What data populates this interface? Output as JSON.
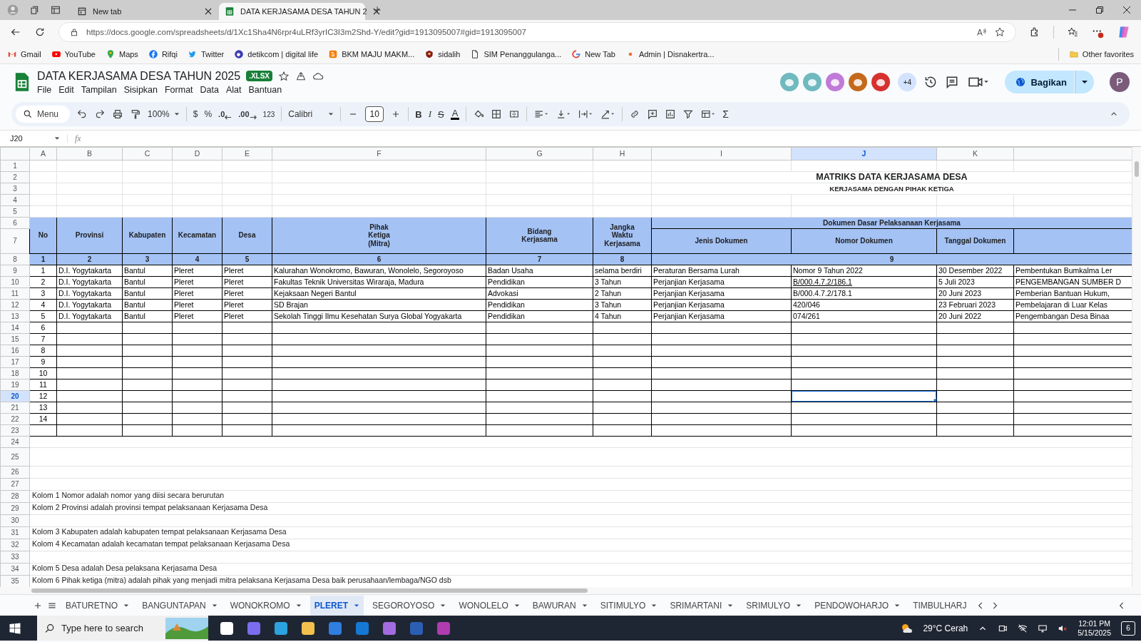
{
  "browser": {
    "tabs": [
      {
        "title": "New tab",
        "kind": "page",
        "selected": false
      },
      {
        "title": "DATA KERJASAMA DESA TAHUN 2",
        "kind": "sheets",
        "selected": true
      }
    ],
    "url": "https://docs.google.com/spreadsheets/d/1Xc1Sha4N6rpr4uLRf3yrIC3I3m2Shd-Y/edit?gid=1913095007#gid=1913095007",
    "bookmarks": [
      {
        "label": "Gmail",
        "kind": "envelope"
      },
      {
        "label": "YouTube",
        "kind": "play"
      },
      {
        "label": "Maps",
        "kind": "pin"
      },
      {
        "label": "Rifqi",
        "kind": "round"
      },
      {
        "label": "Twitter",
        "kind": "bird"
      },
      {
        "label": "detikcom | digital life",
        "kind": "ring"
      },
      {
        "label": "BKM MAJU MAKM...",
        "kind": "square"
      },
      {
        "label": "sidalih",
        "kind": "emblem"
      },
      {
        "label": "SIM Penanggulanga...",
        "kind": "page"
      },
      {
        "label": "New Tab",
        "kind": "multi"
      },
      {
        "label": "Admin | Disnakertra...",
        "kind": "dot"
      }
    ],
    "other_favorites": "Other favorites"
  },
  "doc": {
    "title": "DATA KERJASAMA DESA TAHUN 2025",
    "badge": ".XLSX",
    "menus": [
      "File",
      "Edit",
      "Tampilan",
      "Sisipkan",
      "Format",
      "Data",
      "Alat",
      "Bantuan"
    ],
    "collaborators": [
      {
        "color": "#6fb9bf"
      },
      {
        "color": "#6fb9bf"
      },
      {
        "color": "#c07ad8"
      },
      {
        "color": "#c4691c"
      },
      {
        "color": "#d6312f"
      }
    ],
    "more_collaborators": "+4",
    "share": "Bagikan",
    "profile": "P"
  },
  "toolbar": {
    "search": "Menu",
    "zoom": "100%",
    "currency": "$",
    "percent": "%",
    "decrease_decimal": ".0",
    "increase_decimal": ".00",
    "number_format": "123",
    "font": "Calibri",
    "font_size": "10",
    "bold": "B",
    "italic": "I",
    "strikethrough": "S",
    "text_color": "A",
    "functions": "Σ"
  },
  "formula_bar": {
    "cell_ref": "J20",
    "fx": "fx"
  },
  "sheet": {
    "columns": [
      {
        "label": "A",
        "selected": false
      },
      {
        "label": "B",
        "selected": false
      },
      {
        "label": "C",
        "selected": false
      },
      {
        "label": "D",
        "selected": false
      },
      {
        "label": "E",
        "selected": false
      },
      {
        "label": "F",
        "selected": false
      },
      {
        "label": "G",
        "selected": false
      },
      {
        "label": "H",
        "selected": false
      },
      {
        "label": "I",
        "selected": false
      },
      {
        "label": "J",
        "selected": true
      },
      {
        "label": "K",
        "selected": false
      }
    ],
    "rows": [
      {
        "label": "1",
        "selected": false
      },
      {
        "label": "2",
        "selected": false
      },
      {
        "label": "3",
        "selected": false
      },
      {
        "label": "4",
        "selected": false
      },
      {
        "label": "5",
        "selected": false
      },
      {
        "label": "6",
        "selected": false
      },
      {
        "label": "7",
        "selected": false
      },
      {
        "label": "8",
        "selected": false
      },
      {
        "label": "9",
        "selected": false
      },
      {
        "label": "10",
        "selected": false
      },
      {
        "label": "11",
        "selected": false
      },
      {
        "label": "12",
        "selected": false
      },
      {
        "label": "13",
        "selected": false
      },
      {
        "label": "14",
        "selected": false
      },
      {
        "label": "15",
        "selected": false
      },
      {
        "label": "16",
        "selected": false
      },
      {
        "label": "17",
        "selected": false
      },
      {
        "label": "18",
        "selected": false
      },
      {
        "label": "19",
        "selected": false
      },
      {
        "label": "20",
        "selected": true
      },
      {
        "label": "21",
        "selected": false
      },
      {
        "label": "22",
        "selected": false
      },
      {
        "label": "23",
        "selected": false
      },
      {
        "label": "24",
        "selected": false
      },
      {
        "label": "25",
        "selected": false
      },
      {
        "label": "26",
        "selected": false
      },
      {
        "label": "27",
        "selected": false
      },
      {
        "label": "28",
        "selected": false
      },
      {
        "label": "29",
        "selected": false
      },
      {
        "label": "30",
        "selected": false
      },
      {
        "label": "31",
        "selected": false
      },
      {
        "label": "32",
        "selected": false
      },
      {
        "label": "33",
        "selected": false
      },
      {
        "label": "34",
        "selected": false
      },
      {
        "label": "35",
        "selected": false
      }
    ]
  },
  "table": {
    "title": "MATRIKS DATA KERJASAMA DESA",
    "subtitle": "KERJASAMA DENGAN PIHAK KETIGA",
    "columns": [
      "No",
      "Provinsi",
      "Kabupaten",
      "Kecamatan",
      "Desa",
      "Pihak\nKetiga\n(Mitra)",
      "Bidang\nKerjasama",
      "Jangka\nWaktu\nKerjasama"
    ],
    "group": "Dokumen Dasar Pelaksanaan Kerjasama",
    "group_columns": [
      "Jenis Dokumen",
      "Nomor Dokumen",
      "Tanggal Dokumen"
    ],
    "column_numbers": [
      "1",
      "2",
      "3",
      "4",
      "5",
      "6",
      "7",
      "8"
    ],
    "group_number": "9",
    "rows": [
      {
        "cells": [
          "1",
          "D.I. Yogytakarta",
          "Bantul",
          "Pleret",
          "Pleret",
          "Kalurahan Wonokromo, Bawuran, Wonolelo, Segoroyoso",
          "Badan Usaha",
          "selama berdiri",
          "Peraturan Bersama Lurah",
          "Nomor 9 Tahun 2022",
          "30 Desember 2022",
          "Pembentukan Bumkalma Ler"
        ],
        "doc_link": false
      },
      {
        "cells": [
          "2",
          "D.I. Yogytakarta",
          "Bantul",
          "Pleret",
          "Pleret",
          "Fakultas Teknik Universitas Wiraraja, Madura",
          "Pendidikan",
          "3 Tahun",
          "Perjanjian Kerjasama",
          "B/000.4.7.2/186.1",
          "5 Juli 2023",
          "PENGEMBANGAN SUMBER D"
        ],
        "doc_link": true
      },
      {
        "cells": [
          "3",
          "D.I. Yogytakarta",
          "Bantul",
          "Pleret",
          "Pleret",
          "Kejaksaan Negeri Bantul",
          "Advokasi",
          "2 Tahun",
          "Perjanjian Kerjasama",
          "B/000.4.7.2/178.1",
          "20 Juni 2023",
          "Pemberian Bantuan Hukum,"
        ],
        "doc_link": false
      },
      {
        "cells": [
          "4",
          "D.I. Yogytakarta",
          "Bantul",
          "Pleret",
          "Pleret",
          "SD Brajan",
          "Pendidikan",
          "3 Tahun",
          "Perjanjian Kerjasama",
          "420/046",
          "23 Februari 2023",
          "Pembelajaran di Luar Kelas"
        ],
        "doc_link": false
      },
      {
        "cells": [
          "5",
          "D.I. Yogytakarta",
          "Bantul",
          "Pleret",
          "Pleret",
          "Sekolah Tinggi Ilmu Kesehatan Surya Global Yogyakarta",
          "Pendidikan",
          "4 Tahun",
          "Perjanjian Kerjasama",
          "074/261",
          "20 Juni 2022",
          "Pengembangan Desa Binaa"
        ],
        "doc_link": false
      }
    ],
    "empty_rows": [
      "6",
      "7",
      "8",
      "9",
      "10",
      "11",
      "12",
      "13",
      "14"
    ],
    "notes": [
      "Kolom 1 Nomor adalah nomor yang diisi secara berurutan",
      "Kolom 2 Provinsi adalah provinsi tempat pelaksanaan Kerjasama Desa",
      "Kolom 3 Kabupaten adalah kabupaten tempat pelaksanaan Kerjasama Desa",
      "Kolom 4 Kecamatan adalah kecamatan tempat pelaksanaan Kerjasama Desa",
      "Kolom 5 Desa adalah Desa pelaksana Kerjasama Desa",
      "Kolom 6 Pihak ketiga (mitra) adalah pihak yang menjadi mitra pelaksana Kerjasama Desa baik perusahaan/lembaga/NGO dsb"
    ]
  },
  "sheet_tabs": [
    {
      "label": "BATURETNO",
      "selected": false
    },
    {
      "label": "BANGUNTAPAN",
      "selected": false
    },
    {
      "label": "WONOKROMO",
      "selected": false
    },
    {
      "label": "PLERET",
      "selected": true
    },
    {
      "label": "SEGOROYOSO",
      "selected": false
    },
    {
      "label": "WONOLELO",
      "selected": false
    },
    {
      "label": "BAWURAN",
      "selected": false
    },
    {
      "label": "SITIMULYO",
      "selected": false
    },
    {
      "label": "SRIMARTANI",
      "selected": false
    },
    {
      "label": "SRIMULYO",
      "selected": false
    },
    {
      "label": "PENDOWOHARJO",
      "selected": false
    },
    {
      "label": "TIMBULHARJ",
      "selected": false
    }
  ],
  "taskbar": {
    "search_placeholder": "Type here to search",
    "weather": "29°C Cerah",
    "time": "12:01 PM",
    "date": "5/15/2025",
    "notifications": "6"
  }
}
